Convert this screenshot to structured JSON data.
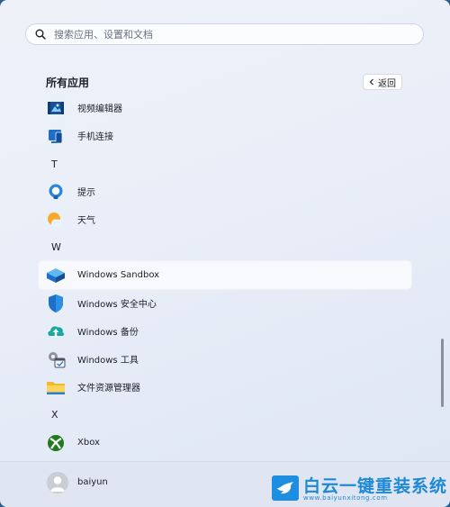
{
  "search": {
    "placeholder": "搜索应用、设置和文档",
    "icon": "search-icon"
  },
  "heading": "所有应用",
  "back_button": {
    "label": "返回",
    "icon": "chevron-left-icon"
  },
  "apps": {
    "video_editor": "视频编辑器",
    "phone_link": "手机连接",
    "tips": "提示",
    "weather": "天气",
    "windows_sandbox": "Windows Sandbox",
    "windows_security": "Windows 安全中心",
    "windows_backup": "Windows 备份",
    "windows_tools": "Windows 工具",
    "file_explorer": "文件资源管理器",
    "xbox": "Xbox"
  },
  "letters": {
    "t": "T",
    "w": "W",
    "x": "X"
  },
  "user": {
    "name": "baiyun"
  },
  "watermark": {
    "title": "白云一键重装系统",
    "url": "www.baiyunxitong.com"
  },
  "colors": {
    "accent": "#1e88d8",
    "selection": "#f8f9fc"
  }
}
